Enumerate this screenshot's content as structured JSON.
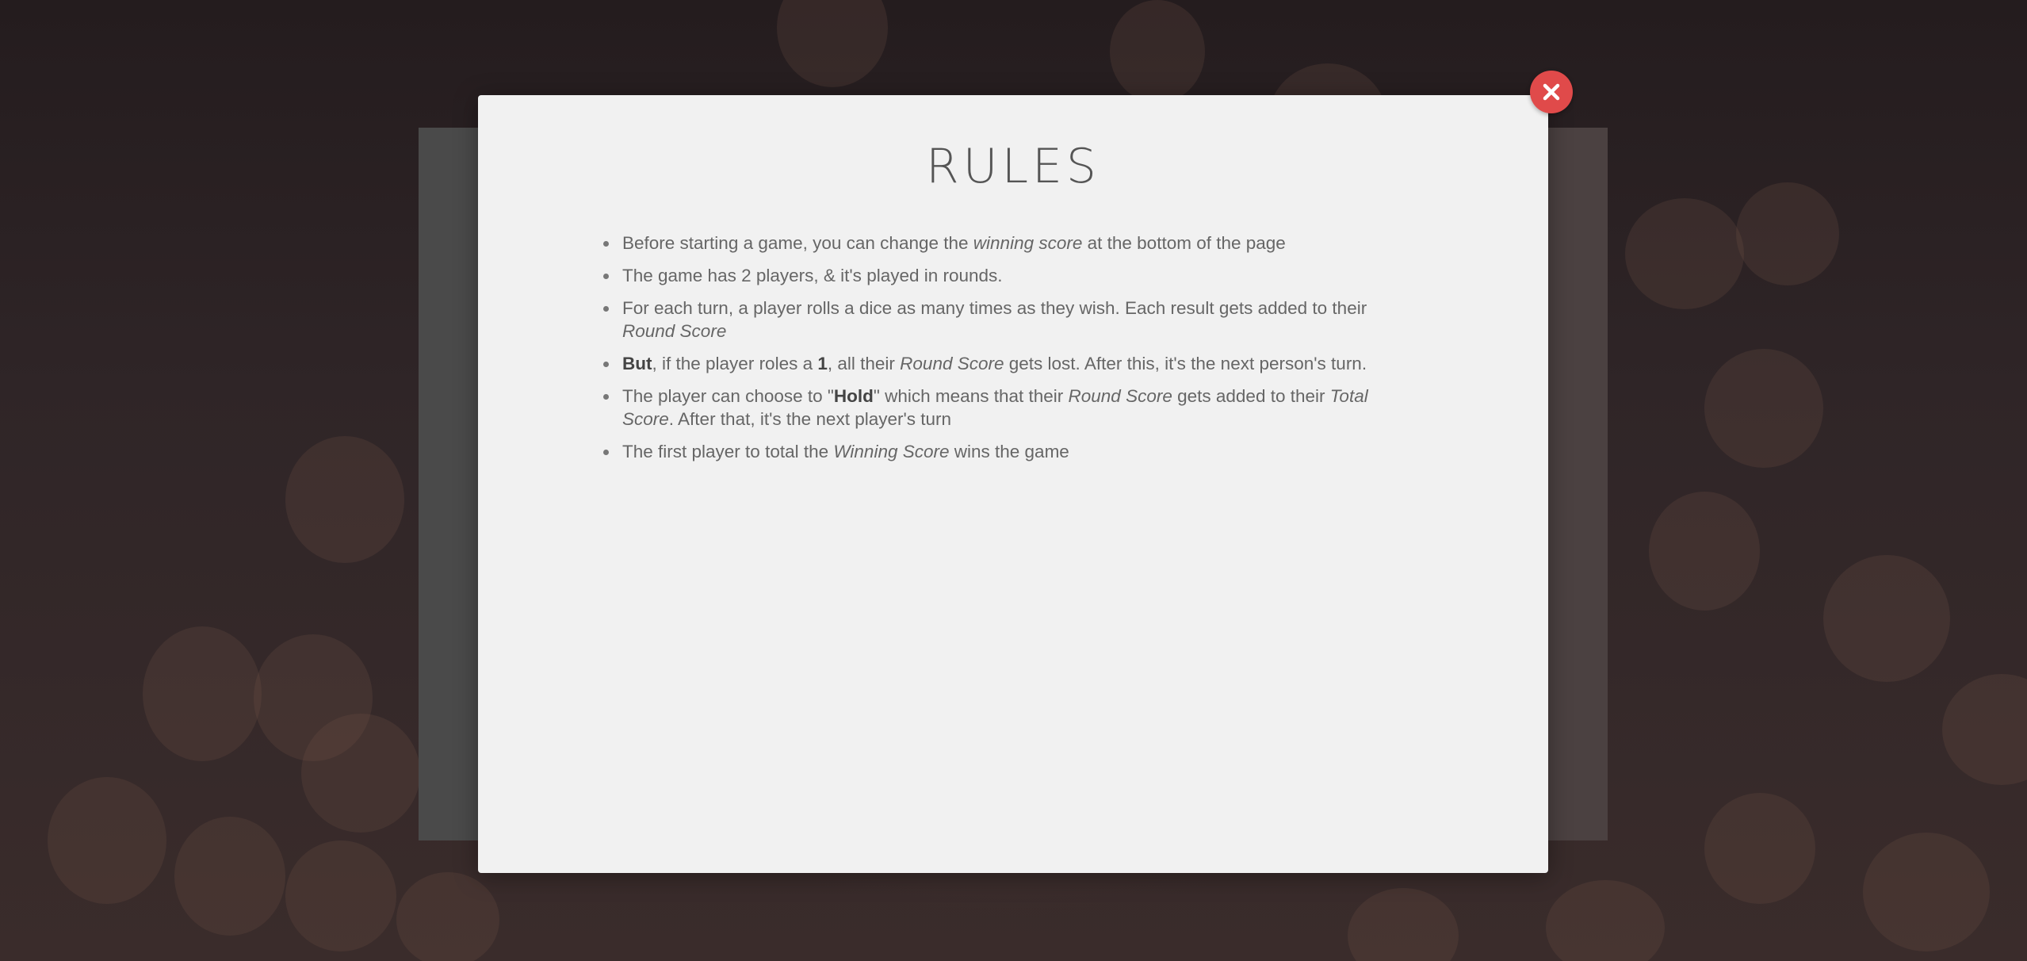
{
  "modal": {
    "title": "RULES",
    "close_icon": "close-icon",
    "rules": [
      {
        "t1": "Before starting a game, you can change the ",
        "i1": "winning score",
        "t2": " at the bottom of the page"
      },
      {
        "t1": "The game has 2 players, & it's played in rounds."
      },
      {
        "t1": "For each turn, a player rolls a dice as many times as they wish. Each result gets added to their ",
        "i1": "Round Score"
      },
      {
        "b1": "But",
        "t1": ", if the player roles a ",
        "b2": "1",
        "t2": ", all their ",
        "i1": "Round Score",
        "t3": " gets lost. After this, it's the next person's turn."
      },
      {
        "t1": "The player can choose to \"",
        "b1": "Hold",
        "t2": "\" which means that their ",
        "i1": "Round Score",
        "t3": " gets added to their ",
        "i2": "Total Score",
        "t4": ". After that, it's the next player's turn"
      },
      {
        "t1": "The first player to total the ",
        "i1": "Winning Score",
        "t2": " wins the game"
      }
    ]
  },
  "colors": {
    "close_button": "#e04a4a",
    "modal_background": "#f1f1f1",
    "left_panel": "#4a4a4a",
    "right_panel": "#4b4141"
  }
}
